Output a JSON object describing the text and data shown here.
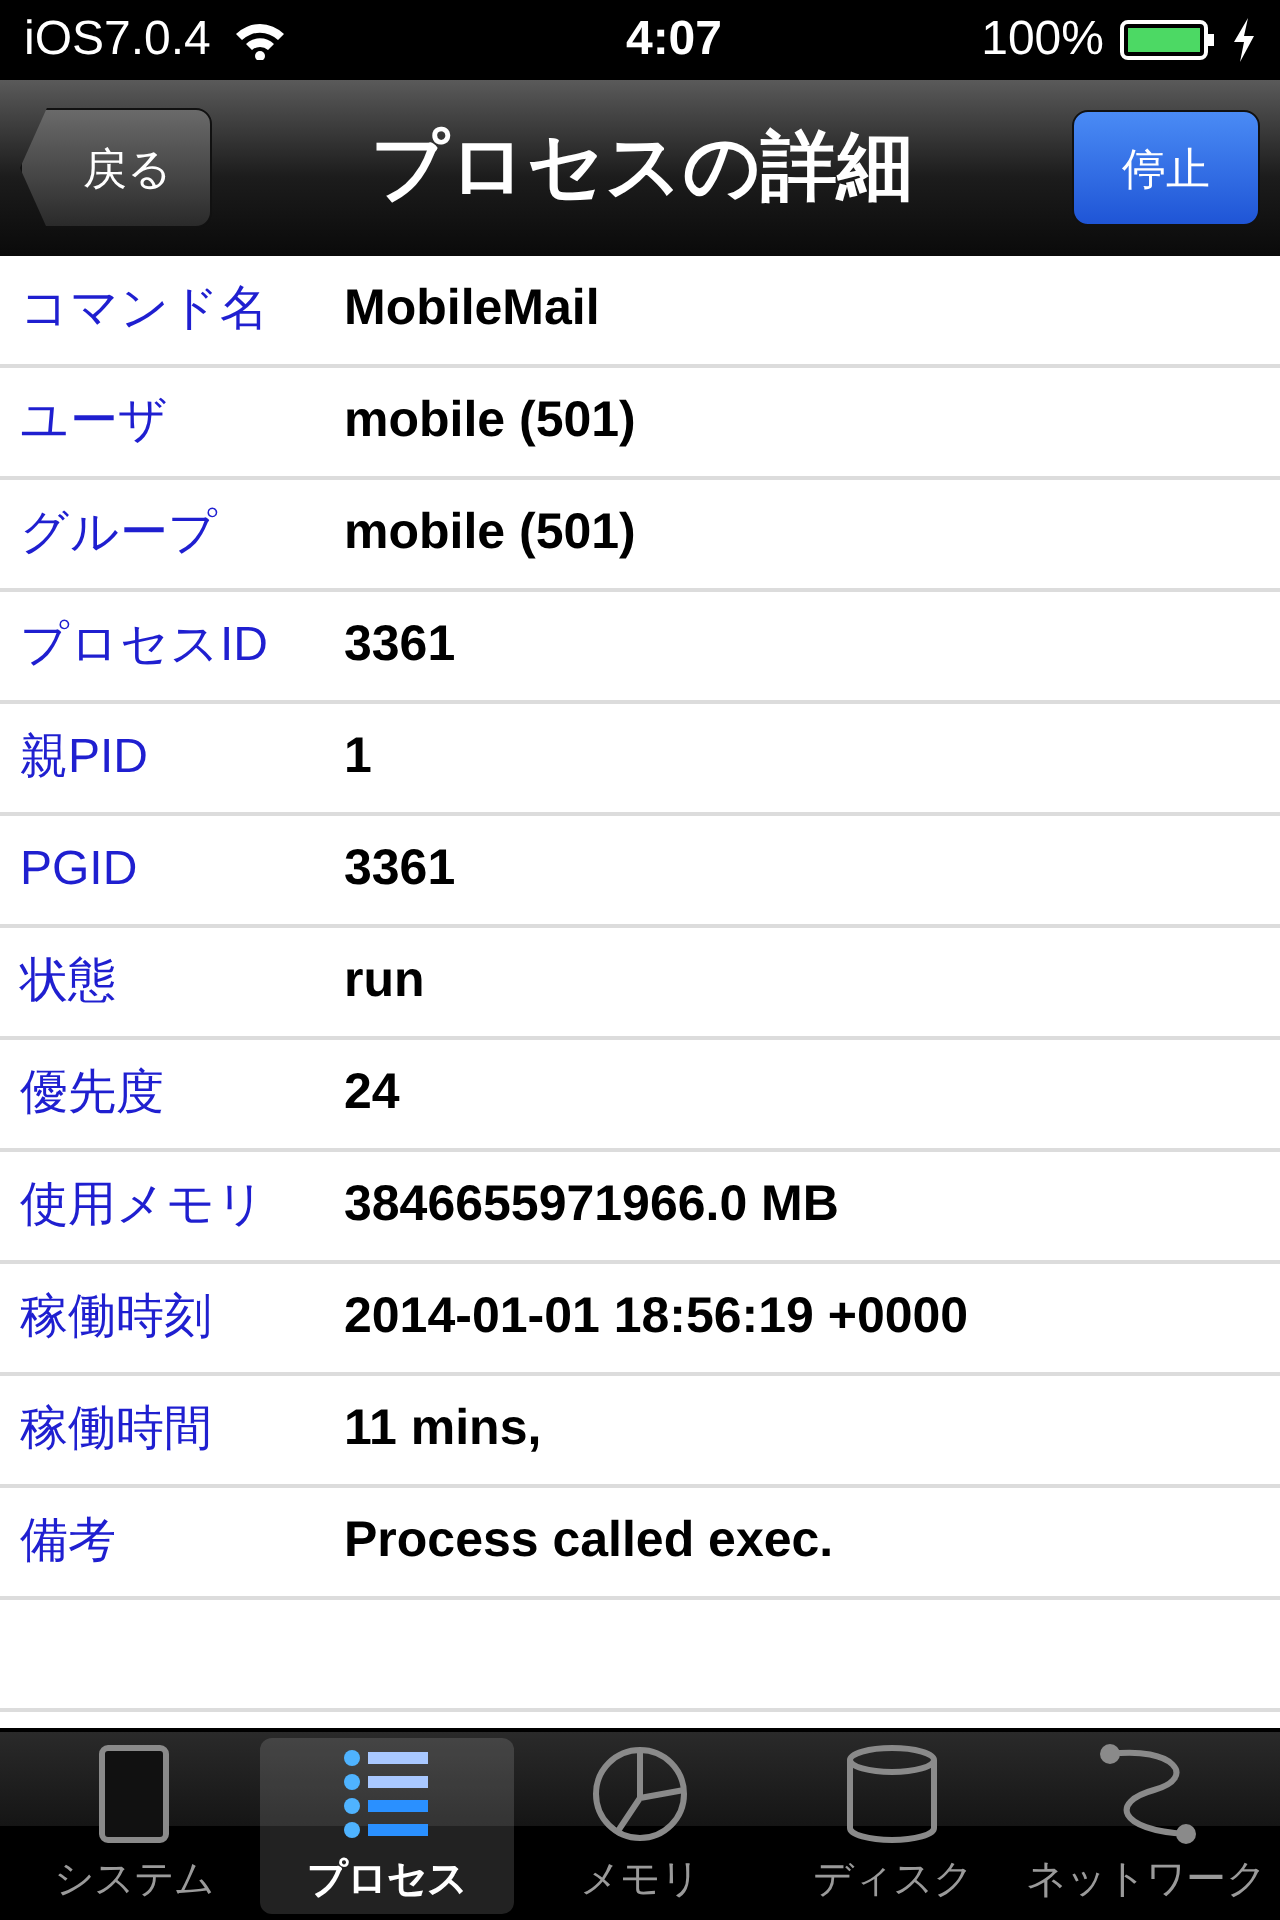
{
  "status_bar": {
    "carrier": "iOS7.0.4",
    "time": "4:07",
    "battery": "100%"
  },
  "nav_bar": {
    "back": "戻る",
    "title": "プロセスの詳細",
    "action": "停止"
  },
  "details": [
    {
      "label": "コマンド名",
      "value": "MobileMail"
    },
    {
      "label": "ユーザ",
      "value": "mobile (501)"
    },
    {
      "label": "グループ",
      "value": "mobile (501)"
    },
    {
      "label": "プロセスID",
      "value": "3361"
    },
    {
      "label": "親PID",
      "value": "1"
    },
    {
      "label": "PGID",
      "value": "3361"
    },
    {
      "label": "状態",
      "value": "run"
    },
    {
      "label": "優先度",
      "value": "24"
    },
    {
      "label": "使用メモリ",
      "value": "3846655971966.0 MB"
    },
    {
      "label": "稼働時刻",
      "value": "2014-01-01 18:56:19 +0000"
    },
    {
      "label": "稼働時間",
      "value": "11 mins,"
    },
    {
      "label": "備考",
      "value": "Process called exec."
    }
  ],
  "tab_bar": [
    {
      "label": "システム",
      "selected": false
    },
    {
      "label": "プロセス",
      "selected": true
    },
    {
      "label": "メモリ",
      "selected": false
    },
    {
      "label": "ディスク",
      "selected": false
    },
    {
      "label": "ネットワーク",
      "selected": false
    }
  ]
}
